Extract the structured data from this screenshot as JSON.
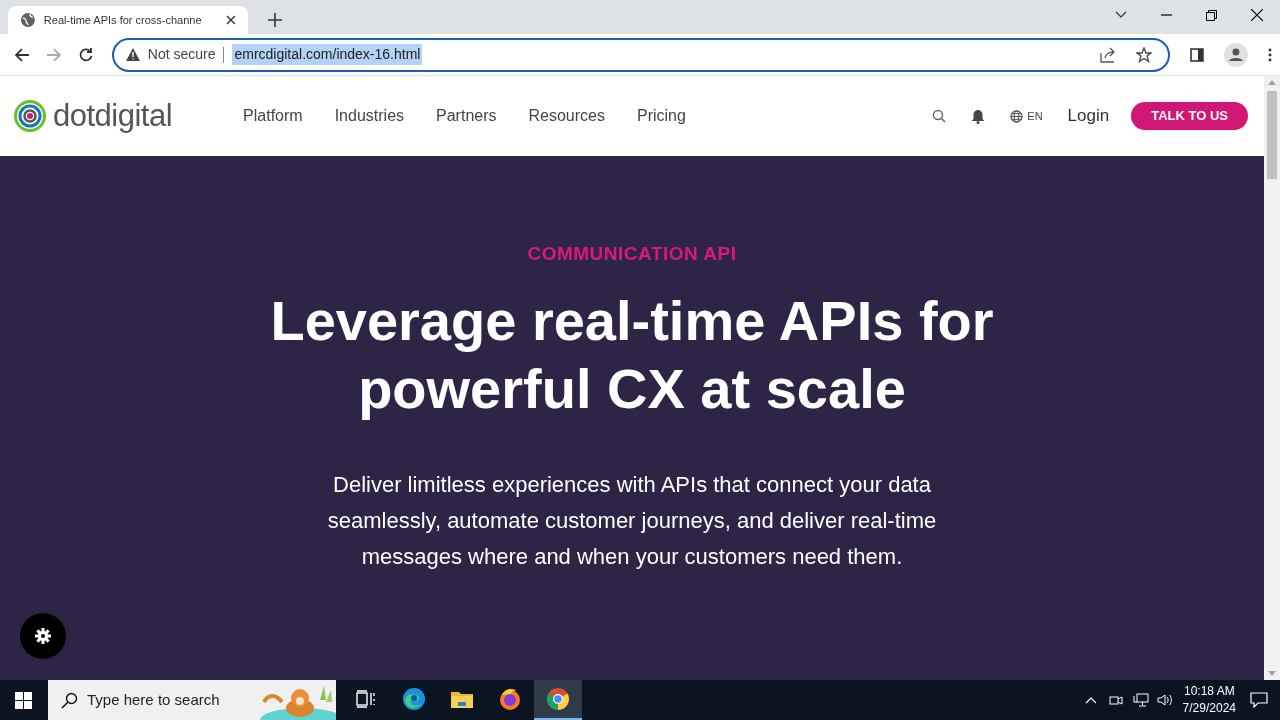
{
  "browser": {
    "tab": {
      "title": "Real-time APIs for cross-channe"
    },
    "security": "Not secure",
    "url": "emrcdigital.com/index-16.html",
    "url_selected": true
  },
  "site": {
    "logo": "dotdigital",
    "nav": [
      "Platform",
      "Industries",
      "Partners",
      "Resources",
      "Pricing"
    ],
    "language": "EN",
    "login": "Login",
    "cta": "TALK TO US"
  },
  "hero": {
    "eyebrow": "COMMUNICATION API",
    "heading": "Leverage real-time APIs for powerful CX at scale",
    "body": "Deliver limitless experiences with APIs that connect your data seamlessly, automate customer journeys, and deliver real-time messages where and when your customers need them."
  },
  "taskbar": {
    "search_placeholder": "Type here to search",
    "apps": [
      {
        "kind": "taskview",
        "selected": false
      },
      {
        "kind": "edge",
        "selected": false
      },
      {
        "kind": "files",
        "selected": false
      },
      {
        "kind": "firefox",
        "selected": false
      },
      {
        "kind": "chrome",
        "selected": true
      }
    ],
    "time": "10:18 AM",
    "date": "7/29/2024"
  }
}
